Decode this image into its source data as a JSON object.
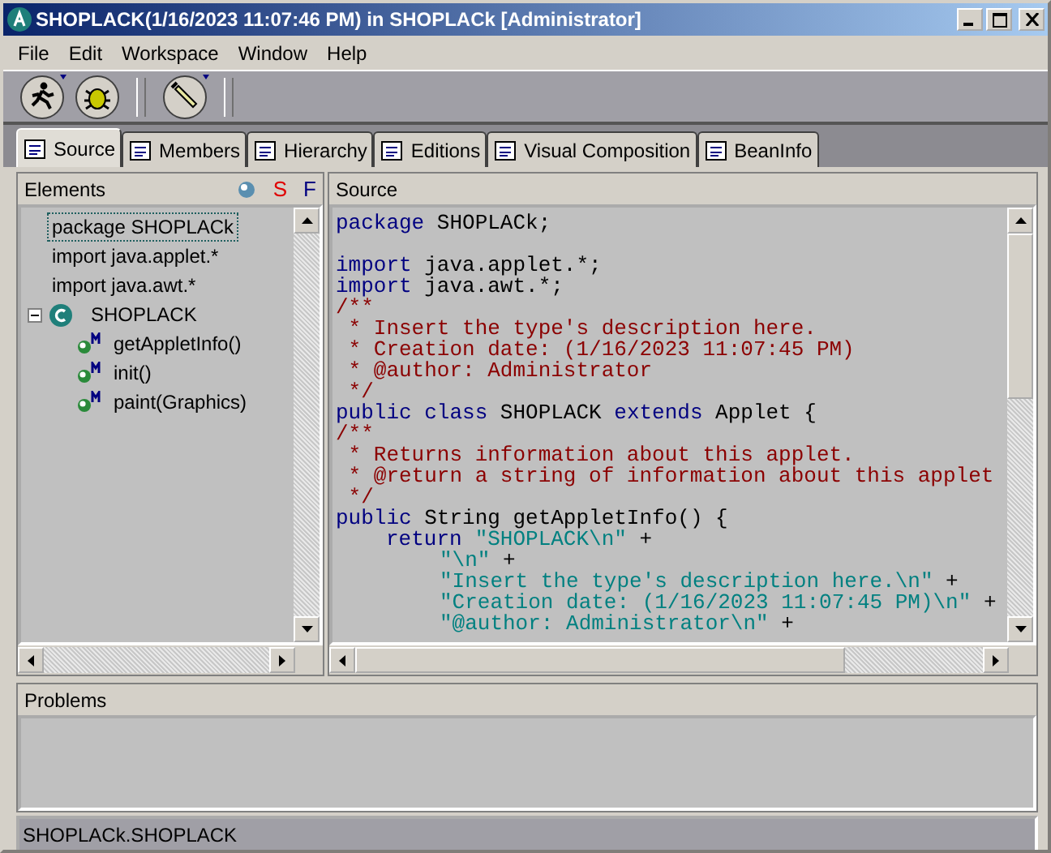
{
  "window": {
    "title": "SHOPLACK(1/16/2023 11:07:46 PM) in SHOPLACk [Administrator]"
  },
  "menu": [
    "File",
    "Edit",
    "Workspace",
    "Window",
    "Help"
  ],
  "tabs": [
    {
      "label": "Source",
      "selected": true
    },
    {
      "label": "Members",
      "selected": false
    },
    {
      "label": "Hierarchy",
      "selected": false
    },
    {
      "label": "Editions",
      "selected": false
    },
    {
      "label": "Visual Composition",
      "selected": false
    },
    {
      "label": "BeanInfo",
      "selected": false
    }
  ],
  "elements": {
    "title": "Elements",
    "filter_s": "S",
    "filter_f": "F",
    "items": [
      {
        "kind": "package",
        "label": "package SHOPLACk",
        "selected": true
      },
      {
        "kind": "import",
        "label": "import java.applet.*",
        "selected": false
      },
      {
        "kind": "import",
        "label": "import java.awt.*",
        "selected": false
      },
      {
        "kind": "class",
        "label": "SHOPLACK",
        "selected": false,
        "expanded": true,
        "children": [
          {
            "kind": "method",
            "label": "getAppletInfo()",
            "selected": false
          },
          {
            "kind": "method",
            "label": "init()",
            "selected": false
          },
          {
            "kind": "method",
            "label": "paint(Graphics)",
            "selected": false
          }
        ]
      }
    ]
  },
  "source": {
    "title": "Source",
    "lines": [
      {
        "kind": "code",
        "segments": [
          {
            "kind": "keyword",
            "text": "package"
          },
          {
            "kind": "plain",
            "text": " SHOPLACk;"
          }
        ]
      },
      {
        "kind": "blank"
      },
      {
        "segments": [
          {
            "kind": "keyword",
            "text": "import"
          },
          {
            "kind": "plain",
            "text": " java.applet.*;"
          }
        ]
      },
      {
        "segments": [
          {
            "kind": "keyword",
            "text": "import"
          },
          {
            "kind": "plain",
            "text": " java.awt.*;"
          }
        ]
      },
      {
        "segments": [
          {
            "kind": "comment",
            "text": "/**"
          }
        ]
      },
      {
        "segments": [
          {
            "kind": "comment",
            "text": " * Insert the type's description here."
          }
        ]
      },
      {
        "segments": [
          {
            "kind": "comment",
            "text": " * Creation date: (1/16/2023 11:07:45 PM)"
          }
        ]
      },
      {
        "segments": [
          {
            "kind": "comment",
            "text": " * @author: Administrator"
          }
        ]
      },
      {
        "segments": [
          {
            "kind": "comment",
            "text": " */"
          }
        ]
      },
      {
        "segments": [
          {
            "kind": "keyword",
            "text": "public class"
          },
          {
            "kind": "plain",
            "text": " SHOPLACK "
          },
          {
            "kind": "keyword",
            "text": "extends"
          },
          {
            "kind": "plain",
            "text": " Applet {"
          }
        ]
      },
      {
        "segments": [
          {
            "kind": "comment",
            "text": "/**"
          }
        ]
      },
      {
        "segments": [
          {
            "kind": "comment",
            "text": " * Returns information about this applet."
          }
        ]
      },
      {
        "segments": [
          {
            "kind": "comment",
            "text": " * @return a string of information about this applet"
          }
        ]
      },
      {
        "segments": [
          {
            "kind": "comment",
            "text": " */"
          }
        ]
      },
      {
        "segments": [
          {
            "kind": "keyword",
            "text": "public"
          },
          {
            "kind": "plain",
            "text": " String getAppletInfo() {"
          }
        ]
      },
      {
        "kind": "statement",
        "segments": [
          {
            "kind": "keyword",
            "text": "return"
          },
          {
            "kind": "string",
            "text": "\"SHOPLACK\\n\""
          },
          {
            "kind": "plain",
            "text": " +"
          }
        ]
      },
      {
        "kind": "continuation",
        "segments": [
          {
            "kind": "string",
            "text": "\"\\n\""
          },
          {
            "kind": "plain",
            "text": " +"
          }
        ]
      },
      {
        "kind": "continuation",
        "segments": [
          {
            "kind": "string",
            "text": "\"Insert the type's description here.\\n\""
          },
          {
            "kind": "plain",
            "text": " +"
          }
        ]
      },
      {
        "kind": "continuation",
        "segments": [
          {
            "kind": "string",
            "text": "\"Creation date: (1/16/2023 11:07:45 PM)\\n\""
          },
          {
            "kind": "plain",
            "text": " +"
          }
        ]
      },
      {
        "kind": "continuation",
        "segments": [
          {
            "kind": "string",
            "text": "\"@author: Administrator\\n\""
          },
          {
            "kind": "plain",
            "text": " +"
          }
        ]
      }
    ]
  },
  "problems": {
    "title": "Problems"
  },
  "status_bar": "SHOPLACk.SHOPLACK"
}
